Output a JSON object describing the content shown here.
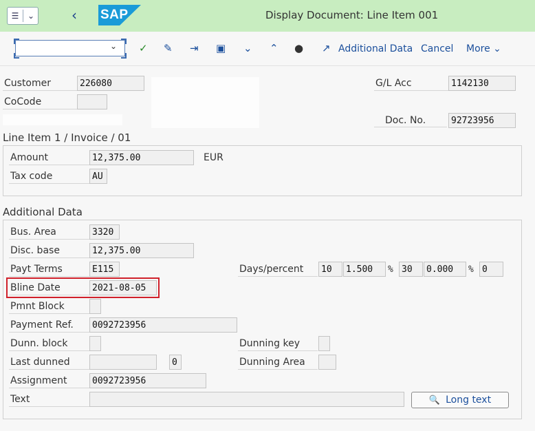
{
  "title": "Display Document: Line Item 001",
  "logo": "SAP",
  "toolbar": {
    "additional_data": "Additional Data",
    "cancel": "Cancel",
    "more": "More"
  },
  "header": {
    "customer_label": "Customer",
    "customer_value": "226080",
    "cocode_label": "CoCode",
    "cocode_value": "",
    "glacc_label": "G/L Acc",
    "glacc_value": "1142130",
    "docno_label": "Doc. No.",
    "docno_value": "92723956"
  },
  "line_item": {
    "title": "Line Item 1 / Invoice / 01",
    "amount_label": "Amount",
    "amount_value": "12,375.00",
    "currency": "EUR",
    "taxcode_label": "Tax code",
    "taxcode_value": "AU"
  },
  "additional": {
    "title": "Additional Data",
    "bus_area_label": "Bus. Area",
    "bus_area_value": "3320",
    "disc_base_label": "Disc. base",
    "disc_base_value": "12,375.00",
    "payt_terms_label": "Payt Terms",
    "payt_terms_value": "E115",
    "days_percent_label": "Days/percent",
    "days1": "10",
    "pct1": "1.500",
    "pct_sym1": "%",
    "days2": "30",
    "pct2": "0.000",
    "pct_sym2": "%",
    "days3": "0",
    "bline_label": "Bline Date",
    "bline_value": "2021-08-05",
    "pmnt_block_label": "Pmnt Block",
    "pmnt_block_value": "",
    "payment_ref_label": "Payment Ref.",
    "payment_ref_value": "0092723956",
    "dunn_block_label": "Dunn. block",
    "dunn_block_value": "",
    "dunning_key_label": "Dunning key",
    "dunning_key_value": "",
    "last_dunned_label": "Last dunned",
    "last_dunned_value": "",
    "last_dunned_level": "0",
    "dunning_area_label": "Dunning Area",
    "dunning_area_value": "",
    "assignment_label": "Assignment",
    "assignment_value": "0092723956",
    "text_label": "Text",
    "text_value": "",
    "long_text_button": "Long text"
  }
}
